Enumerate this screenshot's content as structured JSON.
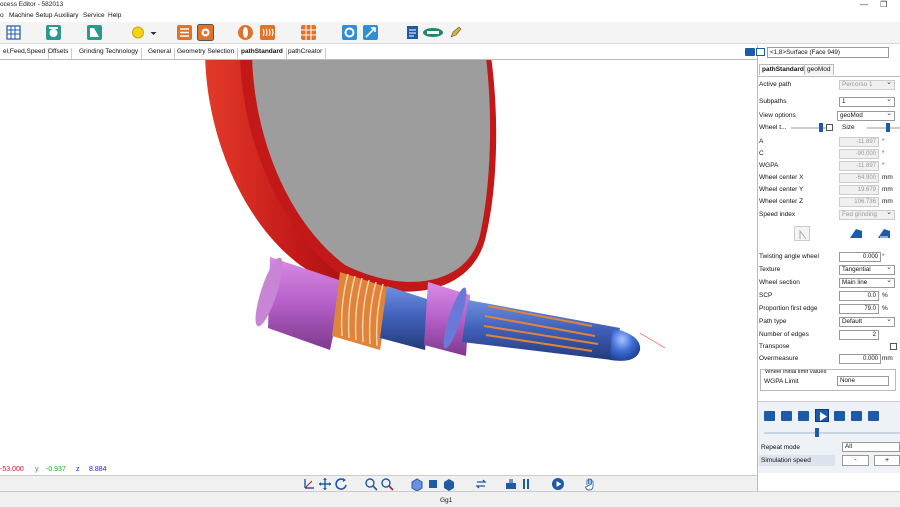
{
  "window": {
    "title": "ocess Editor - 582013",
    "minimize": "—",
    "maximize": "❐"
  },
  "menu": [
    "o",
    "Machine Setup",
    "Auxiliary",
    "Service",
    "Help"
  ],
  "tabs": [
    "el,Feed,Speed",
    "Offsets",
    "Grinding Technology",
    "General",
    "Geometry Selection",
    "pathStandard",
    "pathCreator"
  ],
  "active_tab": "pathStandard",
  "view_selector": "<1,8>Surface (Face 949)",
  "coords": {
    "x_label": "x",
    "x_value": "-53.000",
    "y_label": "y",
    "y_value": "-0.937",
    "z_label": "z",
    "z_value": "8.884"
  },
  "status": "Gg1",
  "panel": {
    "tabs": [
      "pathStandard",
      "geoMod"
    ],
    "active_path_label": "Active path",
    "active_path_value": "Percorso 1",
    "subpaths_label": "Subpaths",
    "subpaths_value": "1",
    "view_options_label": "View options",
    "view_options_value": "geoMod",
    "wheel_t_label": "Wheel t...",
    "size_label": "Size",
    "a_label": "A",
    "a_value": "-11.897",
    "a_unit": "°",
    "c_label": "C",
    "c_value": "-90.000",
    "c_unit": "°",
    "wgpa_label": "WGPA",
    "wgpa_value": "-11.897",
    "wgpa_unit": "°",
    "wcx_label": "Wheel center X",
    "wcx_value": "-64.900",
    "wcx_unit": "mm",
    "wcy_label": "Wheel center Y",
    "wcy_value": "19.679",
    "wcy_unit": "mm",
    "wcz_label": "Wheel center Z",
    "wcz_value": "106.736",
    "wcz_unit": "mm",
    "speed_index_label": "Speed index",
    "speed_index_value": "Fed grinding",
    "twisting_label": "Twisting angle wheel",
    "twisting_value": "0.000",
    "twisting_unit": "°",
    "texture_label": "Texture",
    "texture_value": "Tangential",
    "wheel_section_label": "Wheel section",
    "wheel_section_value": "Main line",
    "scp_label": "SCP",
    "scp_value": "0.0",
    "scp_unit": "%",
    "pfe_label": "Proportion first edge",
    "pfe_value": "79.0",
    "pfe_unit": "%",
    "path_type_label": "Path type",
    "path_type_value": "Default",
    "edges_label": "Number of edges",
    "edges_value": "2",
    "transpose_label": "Transpose",
    "overmeasure_label": "Overmeasure",
    "overmeasure_value": "0.000",
    "overmeasure_unit": "mm",
    "group_label": "Wheel initial limit values",
    "wgpa_limit_label": "WGPA Limit",
    "wgpa_limit_value": "None",
    "repeat_label": "Repeat mode",
    "repeat_value": "All",
    "sim_speed_label": "Simulation speed",
    "sim_minus": "-",
    "sim_plus": "+"
  },
  "colors": {
    "wheel_rim": "#c21818",
    "wheel_face": "#9d9d9d",
    "part_magenta": "#b55fc7",
    "part_blue": "#3f5fb8",
    "part_orange": "#e0843c",
    "accent": "#1d5aa8"
  }
}
